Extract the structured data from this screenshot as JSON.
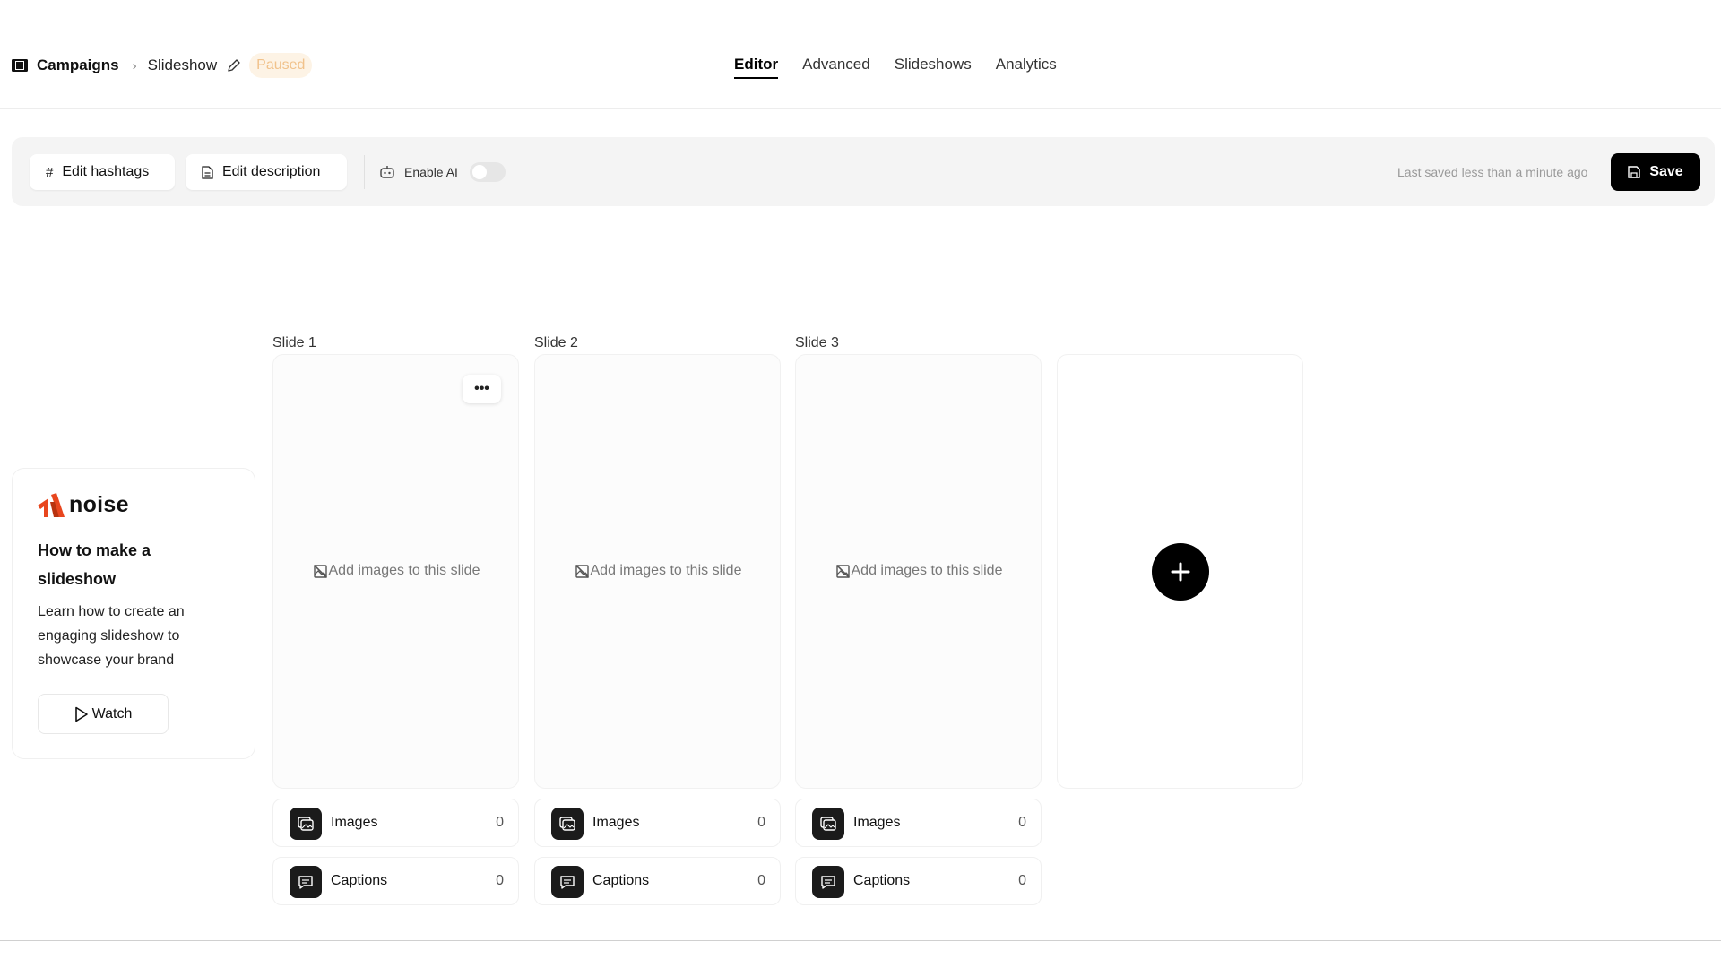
{
  "breadcrumb": {
    "campaigns": "Campaigns",
    "current": "Slideshow",
    "status": "Paused"
  },
  "tabs": [
    {
      "label": "Editor",
      "active": true
    },
    {
      "label": "Advanced",
      "active": false
    },
    {
      "label": "Slideshows",
      "active": false
    },
    {
      "label": "Analytics",
      "active": false
    }
  ],
  "toolbar": {
    "edit_hashtags": "Edit hashtags",
    "edit_description": "Edit description",
    "enable_ai": "Enable AI",
    "enable_ai_on": false,
    "last_saved": "Last saved less than a minute ago",
    "save": "Save"
  },
  "tutorial": {
    "brand": "noise",
    "title": "How to make a slideshow",
    "description": "Learn how to create an engaging slideshow to showcase your brand",
    "watch": "Watch",
    "brand_color": "#e8461e"
  },
  "slides": [
    {
      "label": "Slide 1",
      "placeholder": "Add images to this slide",
      "images_label": "Images",
      "images_count": "0",
      "captions_label": "Captions",
      "captions_count": "0"
    },
    {
      "label": "Slide 2",
      "placeholder": "Add images to this slide",
      "images_label": "Images",
      "images_count": "0",
      "captions_label": "Captions",
      "captions_count": "0"
    },
    {
      "label": "Slide 3",
      "placeholder": "Add images to this slide",
      "images_label": "Images",
      "images_count": "0",
      "captions_label": "Captions",
      "captions_count": "0"
    }
  ],
  "more_menu": "•••"
}
